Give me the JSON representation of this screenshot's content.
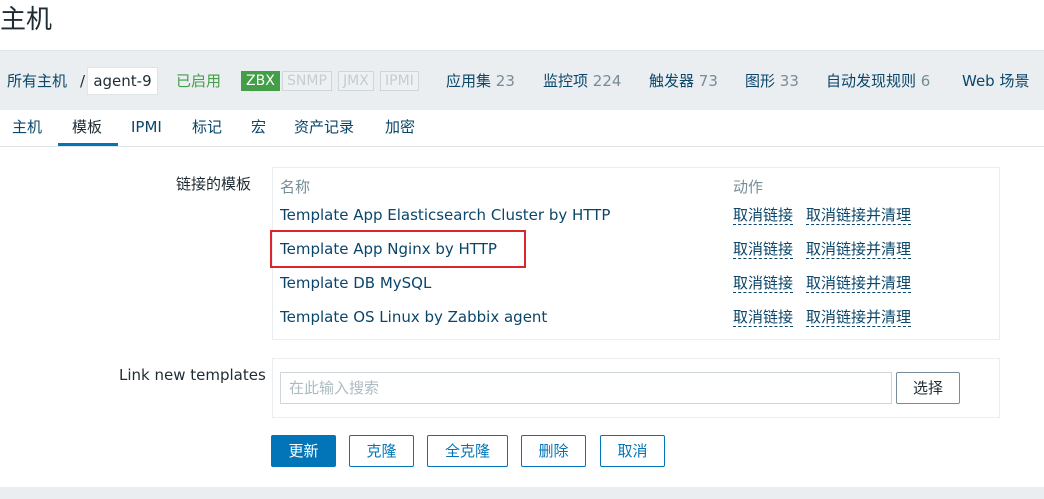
{
  "page": {
    "title": "主机"
  },
  "breadcrumb": {
    "all_hosts": "所有主机",
    "separator": "/",
    "host_name": "agent-9",
    "status": "已启用"
  },
  "availability": {
    "items": [
      {
        "label": "ZBX",
        "active": true
      },
      {
        "label": "SNMP",
        "active": false
      },
      {
        "label": "JMX",
        "active": false
      },
      {
        "label": "IPMI",
        "active": false
      }
    ],
    "active_color": "#429e47"
  },
  "host_nav": {
    "applications": {
      "label": "应用集",
      "count": "23"
    },
    "items": {
      "label": "监控项",
      "count": "224"
    },
    "triggers": {
      "label": "触发器",
      "count": "73"
    },
    "graphs": {
      "label": "图形",
      "count": "33"
    },
    "discovery": {
      "label": "自动发现规则",
      "count": "6"
    },
    "web": {
      "label": "Web 场景"
    }
  },
  "tabs": [
    {
      "label": "主机",
      "active": false
    },
    {
      "label": "模板",
      "active": true
    },
    {
      "label": "IPMI",
      "active": false
    },
    {
      "label": "标记",
      "active": false
    },
    {
      "label": "宏",
      "active": false
    },
    {
      "label": "资产记录",
      "active": false
    },
    {
      "label": "加密",
      "active": false
    }
  ],
  "linked_templates": {
    "label": "链接的模板",
    "col_name": "名称",
    "col_action": "动作",
    "unlink_label": "取消链接",
    "unlink_clear_label": "取消链接并清理",
    "rows": [
      {
        "name": "Template App Elasticsearch Cluster by HTTP"
      },
      {
        "name": "Template App Nginx by HTTP",
        "highlighted": true
      },
      {
        "name": "Template DB MySQL"
      },
      {
        "name": "Template OS Linux by Zabbix agent"
      }
    ]
  },
  "link_new": {
    "label": "Link new templates",
    "placeholder": "在此输入搜索",
    "select_label": "选择"
  },
  "buttons": {
    "update": "更新",
    "clone": "克隆",
    "full_clone": "全克隆",
    "delete": "删除",
    "cancel": "取消"
  },
  "colors": {
    "link": "#0a466a",
    "accent": "#0275b8",
    "highlight_border": "#d9262c"
  }
}
